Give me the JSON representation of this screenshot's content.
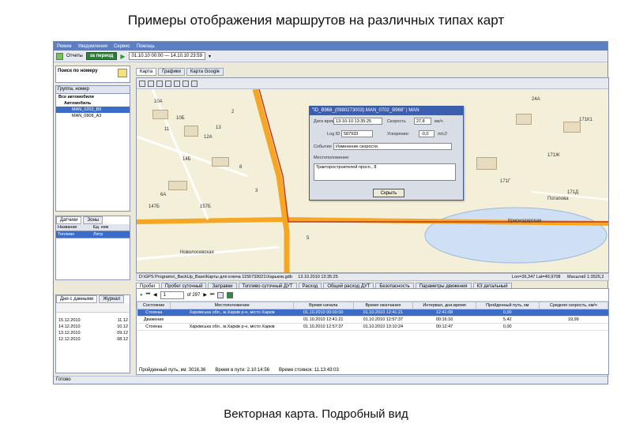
{
  "slide": {
    "title": "Примеры отображения маршрутов на различных типах карт",
    "caption": "Векторная карта. Подробный вид"
  },
  "menu": [
    "Режим",
    "Уведомления",
    "Сервис",
    "Помощь"
  ],
  "toolbar": {
    "reports": "Отчеты",
    "period": "за период",
    "date_range": "01.10.10 00:00 — 14.10.10 23:59"
  },
  "search": {
    "label": "Поиск по номеру"
  },
  "tree": {
    "header": "Группа, номер",
    "rows": [
      "Все автомобили",
      "Автомобиль",
      "MAN_0202_B9",
      "MAN_0808_A3"
    ]
  },
  "sensors": {
    "tabs": [
      "Датчики",
      "Зоны"
    ],
    "columns": [
      "Название",
      "Ед. изм"
    ],
    "row": [
      "Топливо",
      "Литр"
    ]
  },
  "days": {
    "tabs": [
      "Дни с данными",
      "Журнал"
    ],
    "rows": [
      [
        "15.12.2010",
        "11.12"
      ],
      [
        "14.12.2010",
        "10.12"
      ],
      [
        "13.12.2010",
        "09.12"
      ],
      [
        "12.12.2010",
        "08.12"
      ]
    ]
  },
  "map_tabs": [
    "Карта",
    "Графики",
    "Карта Google"
  ],
  "dialog": {
    "title": "\"ID_B968_(0980273003) MAN_0702_B968\" | MAN",
    "time_label": "Дата время",
    "time_value": "13-10-10 13:35:25",
    "speed_label": "Скорость",
    "speed_value": "27,8",
    "speed_unit": "км/ч",
    "log_label": "Log ID",
    "log_value": "587933",
    "accel_label": "Ускорение:",
    "accel_value": "-0,0",
    "accel_unit": "m/c2",
    "event_label": "Событие",
    "event_value": "Изменение скорости",
    "location_label": "Местоположение:",
    "location_value": "Тракторостроителей просп., 8",
    "close": "Скрыть"
  },
  "map_labels": [
    "10A",
    "10Б",
    "12A",
    "14Б",
    "24A",
    "171К1",
    "171Ж",
    "171Г",
    "171Д",
    "11",
    "13",
    "2",
    "8",
    "6A",
    "3",
    "5",
    "Краснодарская",
    "Новолосевская",
    "Потапова",
    "147Б",
    "157Б"
  ],
  "map_status": {
    "path": "D:\\GPS Programs\\_BackUp_Base\\Карты для ключа 1156733021\\Харьков.gdb",
    "date": "13.10.2010 13:35:25",
    "coords": "Lon=36,347  Lat=49,9708",
    "scale": "Масштаб 1:3526,2"
  },
  "bottom_tabs": [
    "Пробег",
    "Пробег суточный",
    "Заправки",
    "Топливо суточный ДУТ",
    "Расход",
    "Общий расход ДУТ",
    "Безопасность",
    "Параметры движения",
    "КЗ детальный"
  ],
  "pager": {
    "page": "1",
    "of": "of 297"
  },
  "table": {
    "columns": [
      "Состояние",
      "Местоположение",
      "Время начала",
      "Время окончания",
      "Интервал, дни.время",
      "Пройденный путь, км",
      "Средняя скорость, км/ч"
    ],
    "rows": [
      [
        "Стоянка",
        "Харківська обл., м.Харків р-н, місто Харків",
        "01.10.2010 00:00:00",
        "01.10.2010 12:41:21",
        "12:41:08",
        "0,00",
        ""
      ],
      [
        "Движение",
        "",
        "01.10.2010 12:41:21",
        "01.10.2010 12:57:37",
        "00:16:16",
        "5,42",
        "19,99"
      ],
      [
        "Стоянка",
        "Харківська обл., м.Харків р-н, місто Харків",
        "01.10.2010 12:57:37",
        "01.10.2010 13:10:24",
        "00:12:47",
        "0,00",
        ""
      ]
    ]
  },
  "summary": {
    "path": "Пройденный путь, км:  3016,36",
    "moving": "Время в пути:  2.10:14:56",
    "stops": "Время стоянок:  11.13:43:03"
  },
  "status": "Готово"
}
